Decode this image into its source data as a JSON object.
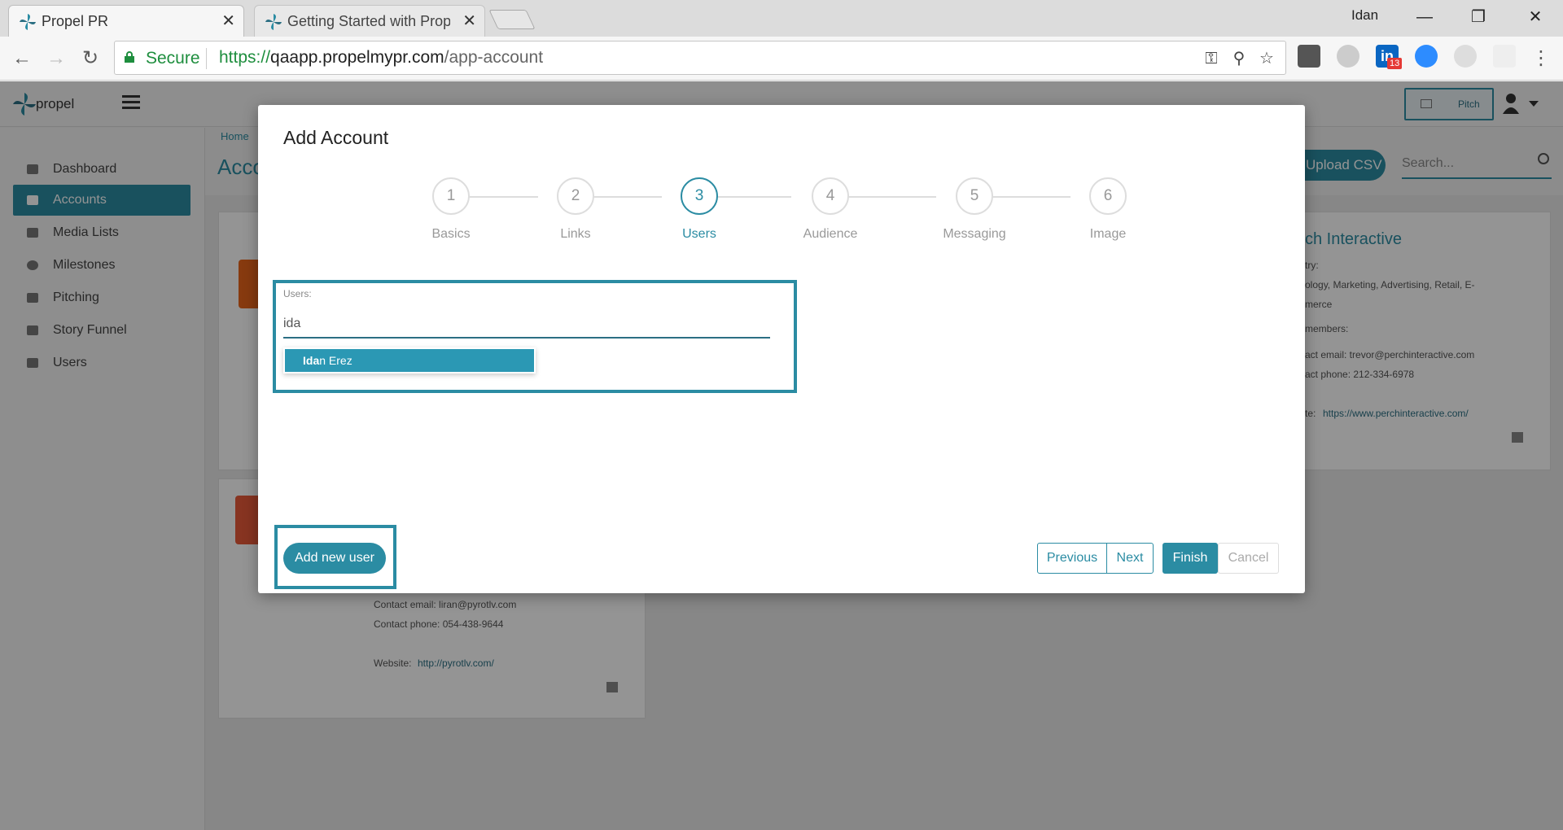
{
  "browser": {
    "tabs": [
      {
        "title": "Propel PR",
        "active": true
      },
      {
        "title": "Getting Started with Prop",
        "active": false
      }
    ],
    "window_user": "Idan",
    "secure_label": "Secure",
    "url_scheme": "https://",
    "url_host": "qaapp.propelmypr.com",
    "url_path": "/app-account",
    "extension_badge": "13"
  },
  "app": {
    "logo_text": "propel",
    "pitch_label": "Pitch",
    "sidebar": [
      {
        "label": "Dashboard",
        "icon": "dashboard-icon"
      },
      {
        "label": "Accounts",
        "icon": "monitor-icon",
        "active": true
      },
      {
        "label": "Media Lists",
        "icon": "list-icon"
      },
      {
        "label": "Milestones",
        "icon": "target-icon"
      },
      {
        "label": "Pitching",
        "icon": "envelope-icon"
      },
      {
        "label": "Story Funnel",
        "icon": "funnel-icon"
      },
      {
        "label": "Users",
        "icon": "users-icon"
      }
    ],
    "breadcrumb": "Home",
    "page_title_partial": "Acco",
    "upload_csv": "Upload CSV",
    "search_placeholder": "Search..."
  },
  "background_cards": {
    "right_card": {
      "title_partial": "ch Interactive",
      "industry_label": "try:",
      "industry_line1": "ology, Marketing, Advertising, Retail, E-",
      "industry_line2": "merce",
      "members_label": "members:",
      "contact_email": "act email: trevor@perchinteractive.com",
      "contact_phone": "act phone: 212-334-6978",
      "website_label": "te:",
      "website_url": "https://www.perchinteractive.com/"
    },
    "left_card": {
      "contact_email": "Contact email: liran@pyrotlv.com",
      "contact_phone": "Contact phone: 054-438-9644",
      "website_label": "Website:",
      "website_url": "http://pyrotlv.com/"
    }
  },
  "modal": {
    "title": "Add Account",
    "steps": [
      {
        "number": "1",
        "label": "Basics"
      },
      {
        "number": "2",
        "label": "Links"
      },
      {
        "number": "3",
        "label": "Users",
        "current": true
      },
      {
        "number": "4",
        "label": "Audience"
      },
      {
        "number": "5",
        "label": "Messaging"
      },
      {
        "number": "6",
        "label": "Image"
      }
    ],
    "users_label": "Users:",
    "users_input_value": "ida",
    "suggestion_match": "Ida",
    "suggestion_rest": "n Erez",
    "add_new_user": "Add new user",
    "previous": "Previous",
    "next": "Next",
    "finish": "Finish",
    "cancel": "Cancel"
  },
  "colors": {
    "accent": "#2b8ca3",
    "secure_green": "#1e8e3e"
  }
}
